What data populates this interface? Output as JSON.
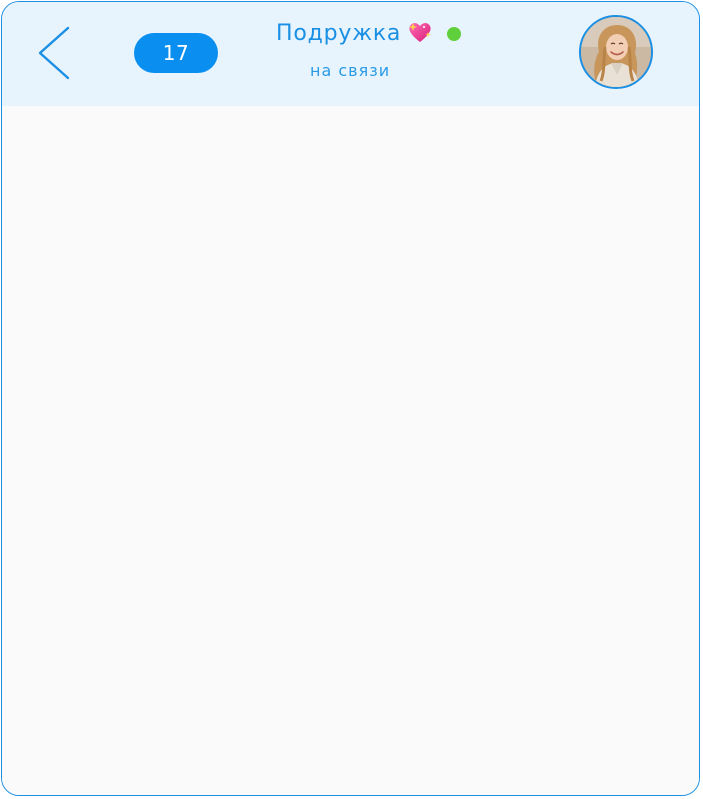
{
  "header": {
    "back_icon": "chevron-left-icon",
    "unread_count": "17",
    "contact_name": "Подружка",
    "name_icon": "sparkling-heart-icon",
    "online_indicator": "online-dot",
    "status": "на связи",
    "avatar": "contact-avatar-photo"
  },
  "colors": {
    "accent": "#1a8fe3",
    "badge": "#0a8ff0",
    "header_bg": "#e8f4fd",
    "online": "#5fcf3c",
    "chat_bg": "#fafafa"
  }
}
